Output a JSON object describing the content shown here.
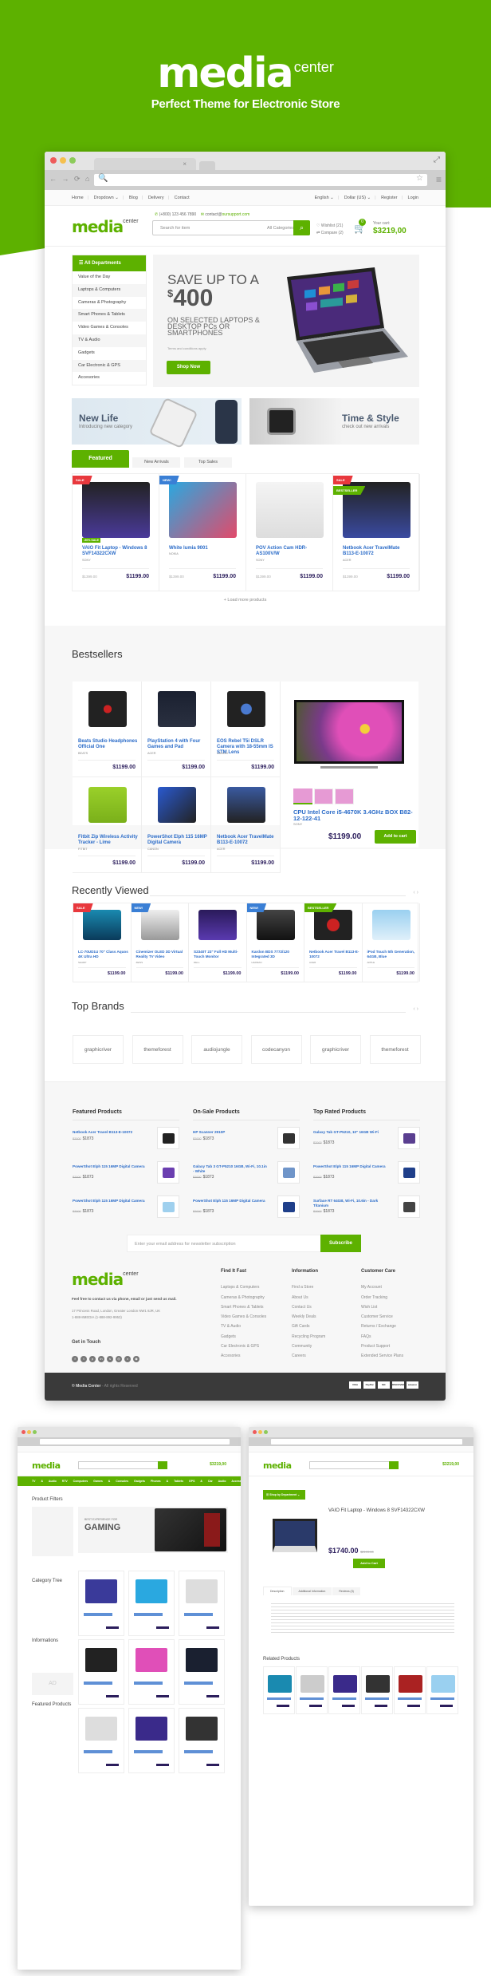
{
  "hero": {
    "logo_main": "media",
    "logo_sub": "center",
    "tagline": "Perfect Theme for Electronic Store"
  },
  "browser": {
    "tab_close": "×",
    "maximize_icon": "⤢",
    "nav_arrows": "← → ⟳ ⌂",
    "search_icon": "🔍",
    "star_icon": "☆",
    "menu_icon": "≡"
  },
  "topbar": {
    "left": [
      "Home",
      "Dropdown ⌄",
      "Blog",
      "Delivery",
      "Contact"
    ],
    "right": [
      "English ⌄",
      "Dollar (US) ⌄",
      "Register",
      "Login"
    ]
  },
  "header": {
    "logo_main": "media",
    "logo_sub": "center",
    "phone": "(+800) 123 456 7890",
    "email_prefix": "contact@",
    "email_domain": "oursupport.com",
    "search_placeholder": "Search for item",
    "search_category": "All Categories ⌄",
    "search_button_icon": "⌕",
    "wishlist": "♡ Wishlist (21)",
    "compare": "⇄ Compare (2)",
    "cart_count": "0",
    "cart_label": "Your cart:",
    "cart_total": "$3219,00"
  },
  "departments": {
    "title": "☰  All Departments",
    "items": [
      "Value of the Day",
      "Laptops & Computers",
      "Cameras & Photography",
      "Smart Phones & Tablets",
      "Video Games & Consoles",
      "TV & Audio",
      "Gadgets",
      "Car Electronic & GPS",
      "Accesories"
    ]
  },
  "slider": {
    "line1": "SAVE UP TO A",
    "currency": "$",
    "amount": "400",
    "line3": "ON SELECTED LAPTOPS & DESKTOP PCs OR SMARTPHONES",
    "terms": "Terms and conditions apply.",
    "button": "Shop Now"
  },
  "banners": [
    {
      "title": "New Life",
      "subtitle": "Introducing new category"
    },
    {
      "title": "Time & Style",
      "subtitle": "check out new arrivals"
    }
  ],
  "product_tabs": [
    "Featured",
    "New Arrivals",
    "Top Sales"
  ],
  "featured_products": [
    {
      "ribbon": "SALE",
      "ribbon_color": "#e8383d",
      "discount": "-50% SALE",
      "name": "VAIO Fit Laptop - Windows 8 SVF14322CXW",
      "brand": "SONY",
      "old_price": "$1399.00",
      "price": "$1199.00"
    },
    {
      "ribbon": "NEW!",
      "ribbon_color": "#3a7fd5",
      "discount": "",
      "name": "White lumia 9001",
      "brand": "NOKIA",
      "old_price": "$1399.00",
      "price": "$1199.00"
    },
    {
      "ribbon": "",
      "ribbon_color": "",
      "discount": "",
      "name": "POV Action Cam HDR-AS100V/W",
      "brand": "SONY",
      "old_price": "$1399.00",
      "price": "$1199.00"
    },
    {
      "ribbon": "SALE",
      "ribbon_color": "#e8383d",
      "ribbon2": "BESTSELLER",
      "discount": "",
      "name": "Netbook Acer TravelMate B113-E-10072",
      "brand": "ACER",
      "old_price": "$1399.00",
      "price": "$1199.00"
    }
  ],
  "load_more": "+   Load more products",
  "bestsellers": {
    "title": "Bestsellers",
    "items": [
      {
        "name": "Beats Studio Headphones Official One",
        "brand": "BEATS",
        "price": "$1199.00"
      },
      {
        "name": "PlayStation 4 with Four Games and Pad",
        "brand": "ACER",
        "price": "$1199.00"
      },
      {
        "name": "EOS Rebel T5i DSLR Camera with 18-55mm IS STM Lens",
        "brand": "CANON",
        "price": "$1199.00"
      },
      {
        "name": "Fitbit Zip Wireless Activity Tracker - Lime",
        "brand": "FITBIT",
        "price": "$1199.00"
      },
      {
        "name": "PowerShot Elph 115 16MP Digital Camera",
        "brand": "CANON",
        "price": "$1199.00"
      },
      {
        "name": "Netbook Acer TravelMate B113-E-10072",
        "brand": "ACER",
        "price": "$1199.00"
      }
    ],
    "big": {
      "name": "CPU Intel Core i5-4670K 3.4GHz BOX B82-12-122-41",
      "brand": "SONY",
      "price": "$1199.00",
      "button": "Add to cart"
    }
  },
  "recently_viewed": {
    "title": "Recently Viewed",
    "arrows": "‹  ›",
    "items": [
      {
        "ribbon": "SALE",
        "ribbon_color": "#e8383d",
        "name": "LC-70UD1U 70\" Class Aquos 4K Ultra HD",
        "brand": "SHARP",
        "price": "$1199.00"
      },
      {
        "ribbon": "NEW!",
        "ribbon_color": "#3a7fd5",
        "name": "Cinemizer OLED 3D Virtual Reality TV Video",
        "brand": "ZEISS",
        "price": "$1199.00"
      },
      {
        "ribbon": "",
        "ribbon_color": "",
        "name": "S2340T 23\" Full HD Multi-Touch Monitor",
        "brand": "DELL",
        "price": "$1199.00"
      },
      {
        "ribbon": "NEW!",
        "ribbon_color": "#3a7fd5",
        "name": "Kardon BDS 7772/120 Integrated 3D",
        "brand": "HARMAN",
        "price": "$1199.00"
      },
      {
        "ribbon": "BESTSELLER",
        "ribbon_color": "#5db100",
        "name": "Netbook Acer Travel B113-E-10072",
        "brand": "ACER",
        "price": "$1199.00"
      },
      {
        "ribbon": "",
        "ribbon_color": "",
        "name": "iPod Touch 5th Generation, 64GB, Blue",
        "brand": "APPLE",
        "price": "$1199.00"
      }
    ]
  },
  "top_brands": {
    "title": "Top Brands",
    "arrows": "‹  ›",
    "items": [
      "graphicriver",
      "themeforest",
      "audiojungle",
      "codecanyon",
      "graphicriver",
      "themeforest"
    ]
  },
  "mini_lists": [
    {
      "title": "Featured Products",
      "items": [
        {
          "name": "Netbook Acer Travel B113-E-10072",
          "old": "$2000",
          "price": "$1873",
          "color": "#222"
        },
        {
          "name": "PowerShot Elph 115 16MP Digital Camera",
          "old": "$2000",
          "price": "$1873",
          "color": "#6b3fb0"
        },
        {
          "name": "PowerShot Elph 115 16MP Digital Camera",
          "old": "$2000",
          "price": "$1873",
          "color": "#9fd0ee"
        }
      ]
    },
    {
      "title": "On-Sale Products",
      "items": [
        {
          "name": "HP Scanner 2910P",
          "old": "$2000",
          "price": "$1873",
          "color": "#333"
        },
        {
          "name": "Galaxy Tab 3 GT-P5210 16GB, Wi-Fi, 10.1in - White",
          "old": "$2000",
          "price": "$1873",
          "color": "#6f95c9"
        },
        {
          "name": "PowerShot Elph 115 16MP Digital Camera",
          "old": "$2000",
          "price": "$1873",
          "color": "#1f3f8a"
        }
      ]
    },
    {
      "title": "Top Rated Products",
      "items": [
        {
          "name": "Galaxy Tab GT-P5210, 10\" 16GB Wi-Fi",
          "old": "$2000",
          "price": "$1873",
          "color": "#5a3f90"
        },
        {
          "name": "PowerShot Elph 115 16MP Digital Camera",
          "old": "$2000",
          "price": "$1873",
          "color": "#1f3f8a"
        },
        {
          "name": "Surface RT 64GB, Wi-Fi, 10.6in - Dark Titanium",
          "old": "$2000",
          "price": "$1873",
          "color": "#444"
        }
      ]
    }
  ],
  "newsletter": {
    "placeholder": "Enter your email address for newsletter subscription",
    "button": "Subscribe"
  },
  "footer": {
    "logo_main": "media",
    "logo_sub": "center",
    "tagline": "Feel free to contact us via phone, email or just send us mail.",
    "address": "17 Princess Road, London, Greater London NW1 8JR, UK",
    "phone": "1-888-8MEDIA (1-888-892-9953)",
    "get_in_touch": "Get in Touch",
    "social": [
      "f",
      "t",
      "p",
      "in",
      "s",
      "◎",
      "v",
      "◉"
    ],
    "columns": [
      {
        "title": "Find It Fast",
        "links": [
          "Laptops & Computers",
          "Cameras & Photography",
          "Smart Phones & Tablets",
          "Video Games & Consoles",
          "TV & Audio",
          "Gadgets",
          "Car Electronic & GPS",
          "Accesories"
        ]
      },
      {
        "title": "Information",
        "links": [
          "Find a Store",
          "About Us",
          "Contact Us",
          "Weekly Deals",
          "Gift Cards",
          "Recycling Program",
          "Community",
          "Careers"
        ]
      },
      {
        "title": "Customer Care",
        "links": [
          "My Account",
          "Order Tracking",
          "Wish List",
          "Customer Service",
          "Returns / Exchange",
          "FAQs",
          "Product Support",
          "Extended Service Plans"
        ]
      }
    ],
    "copyright_brand": "© Media Center",
    "copyright_rest": " - All rights Reserved",
    "payments": [
      "VISA",
      "PayPal",
      "MC",
      "DISCOVER",
      "amazon"
    ]
  },
  "category_page": {
    "nav": "TV & Audio   RTV   Computers   Games & Consoles   Gadgets   Phones & Tablets   GPS & Car Audio   Accessories",
    "filters_title": "Product Filters",
    "banner_small": "BEST EXPERIENCE FOR",
    "banner_big": "GAMING",
    "category_tree": "Category Tree",
    "informations": "Informations",
    "ad": "AD",
    "featured": "Featured Products"
  },
  "product_page": {
    "breadcrumb_btn": "☰ Shop by Department ⌄",
    "title": "VAIO Fit Laptop - Windows 8 SVF14322CXW",
    "price": "$1740.00",
    "old_price": "$2199.00",
    "button": "Add to Cart",
    "tabs": [
      "Description",
      "Additional Information",
      "Reviews (3)"
    ],
    "related": "Related Products"
  }
}
